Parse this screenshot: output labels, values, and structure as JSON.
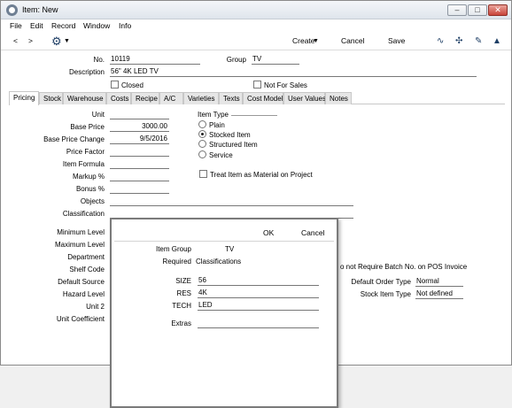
{
  "window": {
    "title": "Item: New"
  },
  "menu": [
    "File",
    "Edit",
    "Record",
    "Window",
    "Info"
  ],
  "toolbar": {
    "create_label": "Create",
    "cancel_label": "Cancel",
    "save_label": "Save"
  },
  "header": {
    "no_label": "No.",
    "no_value": "10119",
    "group_label": "Group",
    "group_value": "TV",
    "description_label": "Description",
    "description_value": "56\" 4K LED TV",
    "closed_label": "Closed",
    "not_for_sales_label": "Not For Sales"
  },
  "tabs": [
    "Pricing",
    "Stock",
    "Warehouse",
    "Costs",
    "Recipe",
    "A/C",
    "Varieties",
    "Texts",
    "Cost Model",
    "User Values",
    "Notes"
  ],
  "pricing": {
    "unit_label": "Unit",
    "unit_value": "",
    "base_price_label": "Base Price",
    "base_price_value": "3000.00",
    "base_price_change_label": "Base Price Change",
    "base_price_change_value": "9/5/2016",
    "price_factor_label": "Price Factor",
    "item_formula_label": "Item Formula",
    "markup_label": "Markup %",
    "bonus_label": "Bonus %",
    "objects_label": "Objects",
    "classification_label": "Classification",
    "item_type_label": "Item Type",
    "item_types": [
      "Plain",
      "Stocked Item",
      "Structured Item",
      "Service"
    ],
    "selected_item_type": "Stocked Item",
    "treat_material_label": "Treat Item as Material on Project"
  },
  "background_fields": {
    "minimum_level_label": "Minimum Level",
    "maximum_level_label": "Maximum Level",
    "department_label": "Department",
    "shelf_code_label": "Shelf Code",
    "default_source_label": "Default Source",
    "hazard_level_label": "Hazard Level",
    "unit2_label": "Unit 2",
    "unit_coefficient_label": "Unit Coefficient",
    "batch_text": "o not Require Batch No. on POS Invoice",
    "default_order_type_label": "Default Order Type",
    "default_order_type_value": "Normal",
    "stock_item_type_label": "Stock Item Type",
    "stock_item_type_value": "Not defined"
  },
  "dialog": {
    "ok_label": "OK",
    "cancel_label": "Cancel",
    "item_group_label": "Item Group",
    "item_group_value": "TV",
    "required_label": "Required",
    "required_value": "Classifications",
    "size_label": "SIZE",
    "size_value": "56",
    "res_label": "RES",
    "res_value": "4K",
    "tech_label": "TECH",
    "tech_value": "LED",
    "extras_label": "Extras",
    "extras_value": ""
  },
  "colors": {
    "window_bg": "#ffffff",
    "close_button": "#c9453a",
    "toolbar_icon": "#1f3f66"
  }
}
